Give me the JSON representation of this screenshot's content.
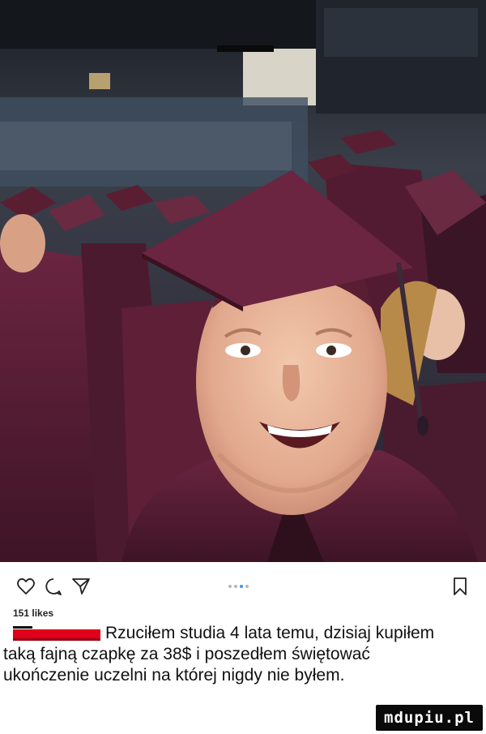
{
  "post": {
    "photo_icon": "graduation-selfie-image",
    "likes": "151 likes",
    "caption": "Rzuciłem studia 4 lata temu, dzisiaj kupiłem taką fajną czapkę za 38$ i poszedłem świętować ukończenie uczelni na której nigdy nie byłem."
  },
  "actions": {
    "like_icon": "heart-icon",
    "comment_icon": "comment-icon",
    "share_icon": "send-icon",
    "save_icon": "bookmark-icon",
    "carousel_icon": "carousel-dots"
  },
  "colors": {
    "gown_maroon": "#5a1e33",
    "username_redaction": "#e0001a",
    "watermark_bg": "#0a0a0a"
  },
  "watermark": {
    "text": "mdupiu.pl"
  }
}
